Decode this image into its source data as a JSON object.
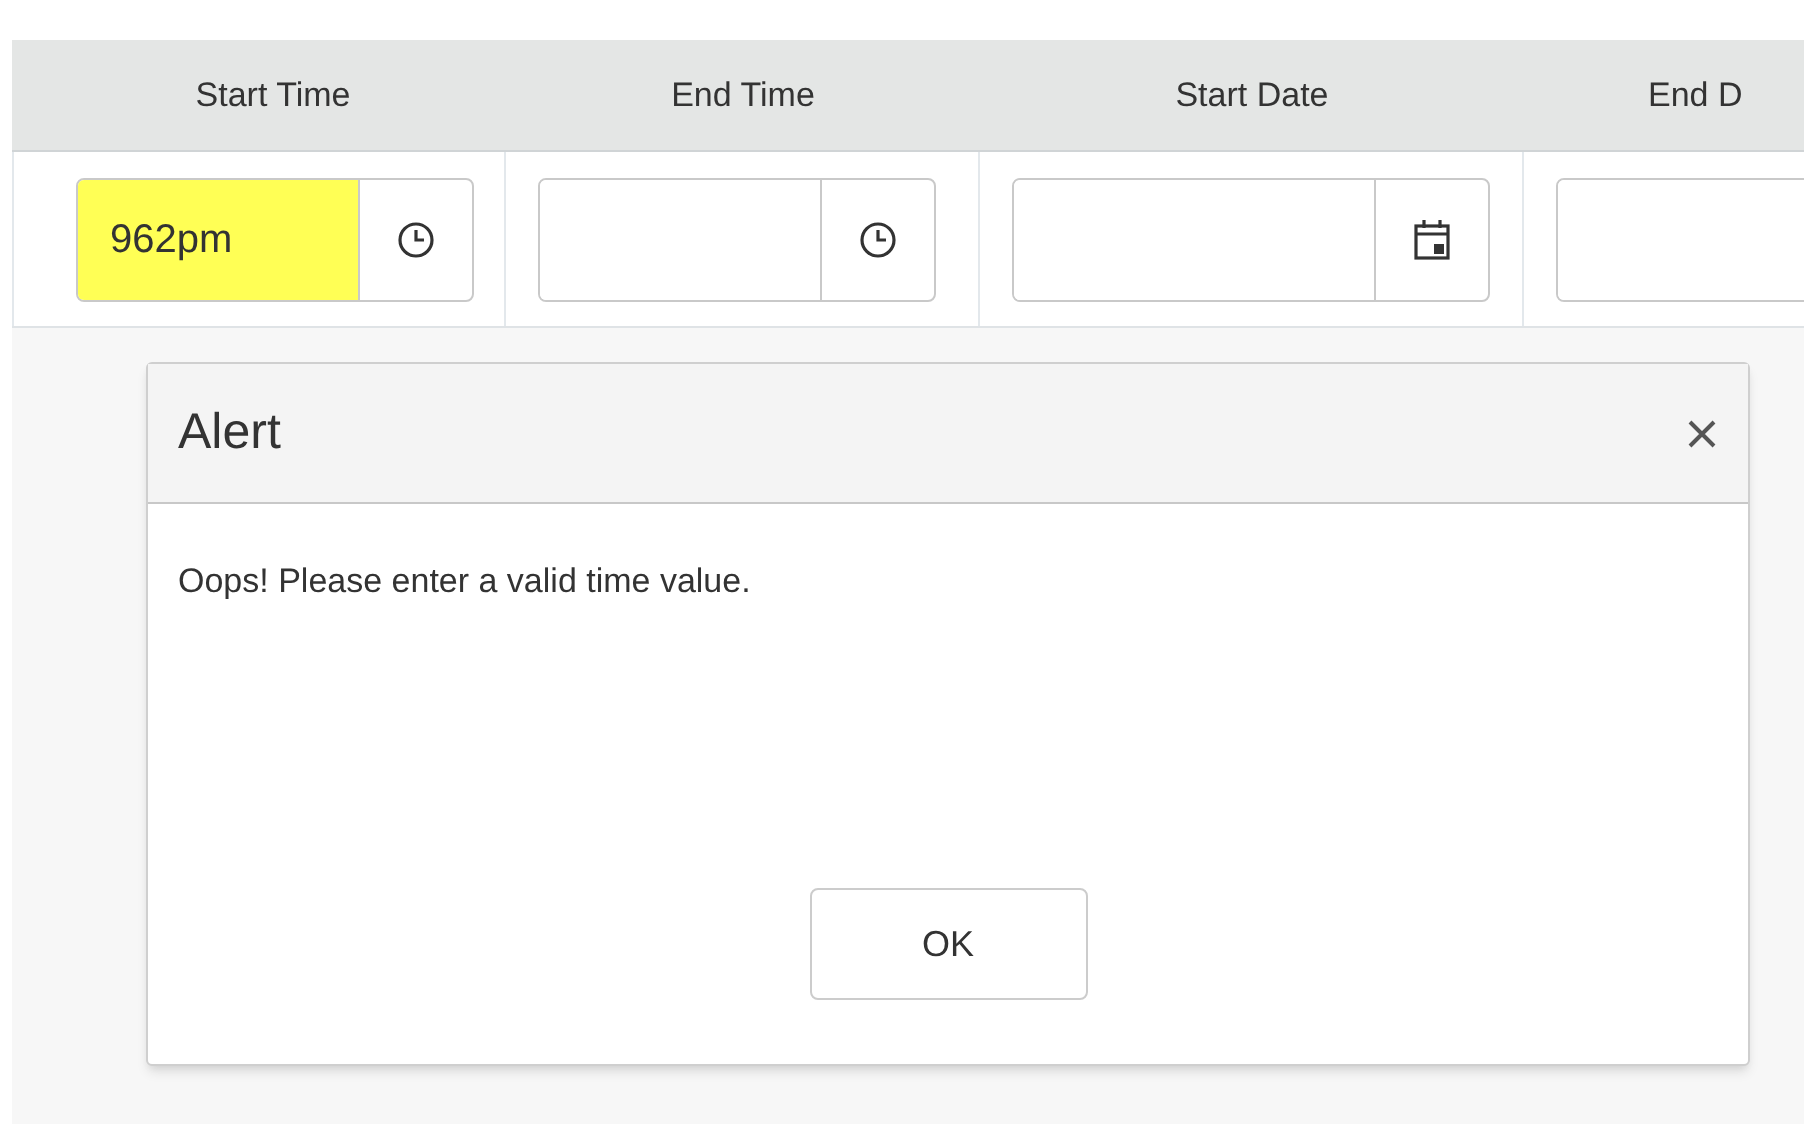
{
  "table": {
    "columns": [
      {
        "header": "Start Time",
        "kind": "time",
        "value": "962pm",
        "invalid": true
      },
      {
        "header": "End Time",
        "kind": "time",
        "invalid": false
      },
      {
        "header": "Start Date",
        "kind": "date",
        "invalid": false
      },
      {
        "header": "End D",
        "kind": "cut",
        "invalid": false
      }
    ]
  },
  "dialog": {
    "title": "Alert",
    "message": "Oops! Please enter a valid time value.",
    "button": "OK"
  }
}
